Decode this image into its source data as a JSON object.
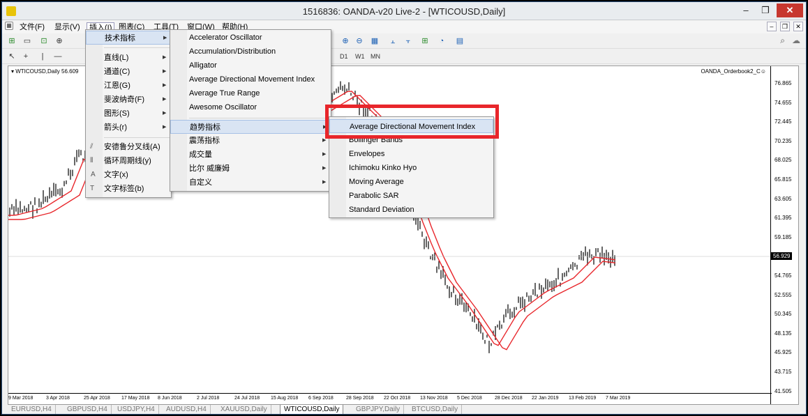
{
  "window": {
    "title": "1516836: OANDA-v20 Live-2 - [WTICOUSD,Daily]",
    "min_glyph": "–",
    "max_glyph": "❐",
    "close_glyph": "✕"
  },
  "menubar": {
    "items": [
      "文件(F)",
      "显示(V)",
      "插入(I)",
      "图表(C)",
      "工具(T)",
      "窗口(W)",
      "帮助(H)"
    ],
    "mdi_min": "–",
    "mdi_restore": "❐",
    "mdi_close": "✕"
  },
  "toolbar": {
    "timeframes": [
      "D1",
      "W1",
      "MN"
    ]
  },
  "chart": {
    "symbol_label": "▾ WTICOUSD,Daily 56.609",
    "indicator_label": "OANDA_Orderbook2_C☺",
    "current_price": "56.929",
    "y_ticks": [
      "76.865",
      "74.655",
      "72.445",
      "70.235",
      "68.025",
      "65.815",
      "63.605",
      "61.395",
      "59.185",
      "54.765",
      "52.555",
      "50.345",
      "48.135",
      "45.925",
      "43.715",
      "41.505"
    ],
    "x_ticks": [
      "9 Mar 2018",
      "3 Apr 2018",
      "25 Apr 2018",
      "17 May 2018",
      "8 Jun 2018",
      "2 Jul 2018",
      "24 Jul 2018",
      "15 Aug 2018",
      "6 Sep 2018",
      "28 Sep 2018",
      "22 Oct 2018",
      "13 Nov 2018",
      "5 Dec 2018",
      "28 Dec 2018",
      "22 Jan 2019",
      "13 Feb 2019",
      "7 Mar 2019"
    ]
  },
  "tabs": [
    "EURUSD,H4",
    "GBPUSD,H4",
    "USDJPY,H4",
    "AUDUSD,H4",
    "XAUUSD,Daily",
    "WTICOUSD,Daily",
    "GBPJPY,Daily",
    "BTCUSD,Daily"
  ],
  "insert_menu": {
    "items": [
      "技术指标",
      "直线(L)",
      "通道(C)",
      "江恩(G)",
      "斐波纳奇(F)",
      "图形(S)",
      "箭头(r)",
      "安德鲁分叉线(A)",
      "循环周期线(y)",
      "文字(x)",
      "文字标签(b)"
    ]
  },
  "indicators_menu": {
    "items": [
      "Accelerator Oscillator",
      "Accumulation/Distribution",
      "Alligator",
      "Average Directional Movement Index",
      "Average True Range",
      "Awesome Oscillator",
      "趋势指标",
      "震荡指标",
      "成交量",
      "比尔 威廉姆",
      "自定义"
    ]
  },
  "trend_menu": {
    "items": [
      "Average Directional Movement Index",
      "Bollinger Bands",
      "Envelopes",
      "Ichimoku Kinko Hyo",
      "Moving Average",
      "Parabolic SAR",
      "Standard Deviation"
    ]
  },
  "colors": {
    "candle": "#000000",
    "ma": "#e8262b",
    "highlight_box": "#e8262b"
  }
}
